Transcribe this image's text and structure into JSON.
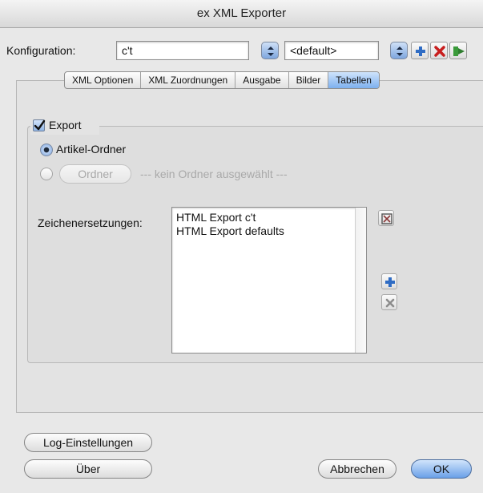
{
  "window": {
    "title": "ex XML Exporter"
  },
  "config": {
    "label": "Konfiguration:",
    "name_value": "c't",
    "preset_value": "<default>"
  },
  "icons": {
    "stepper": "stepper-arrows-icon",
    "add": "plus-icon",
    "delete": "red-x-icon",
    "export": "green-export-arrow-icon",
    "edit": "edit-icon",
    "remove": "gray-x-icon"
  },
  "tabs": [
    {
      "label": "XML Optionen",
      "selected": false
    },
    {
      "label": "XML Zuordnungen",
      "selected": false
    },
    {
      "label": "Ausgabe",
      "selected": false
    },
    {
      "label": "Bilder",
      "selected": false
    },
    {
      "label": "Tabellen",
      "selected": true
    }
  ],
  "export_group": {
    "checkbox_label": "Export",
    "checked": true,
    "radio_article_label": "Artikel-Ordner",
    "radio_article_selected": true,
    "folder_button_label": "Ordner",
    "folder_status": "--- kein Ordner ausgewählt ---",
    "replacements_label": "Zeichenersetzungen:",
    "replacements": [
      "HTML Export c't",
      "HTML Export defaults"
    ]
  },
  "footer": {
    "log_button": "Log-Einstellungen",
    "about_button": "Über",
    "cancel_button": "Abbrechen",
    "ok_button": "OK"
  },
  "colors": {
    "accent": "#6aa0e8",
    "delete_red": "#c81e1e",
    "add_blue": "#2f6cc4",
    "export_green": "#3a9a3a"
  }
}
